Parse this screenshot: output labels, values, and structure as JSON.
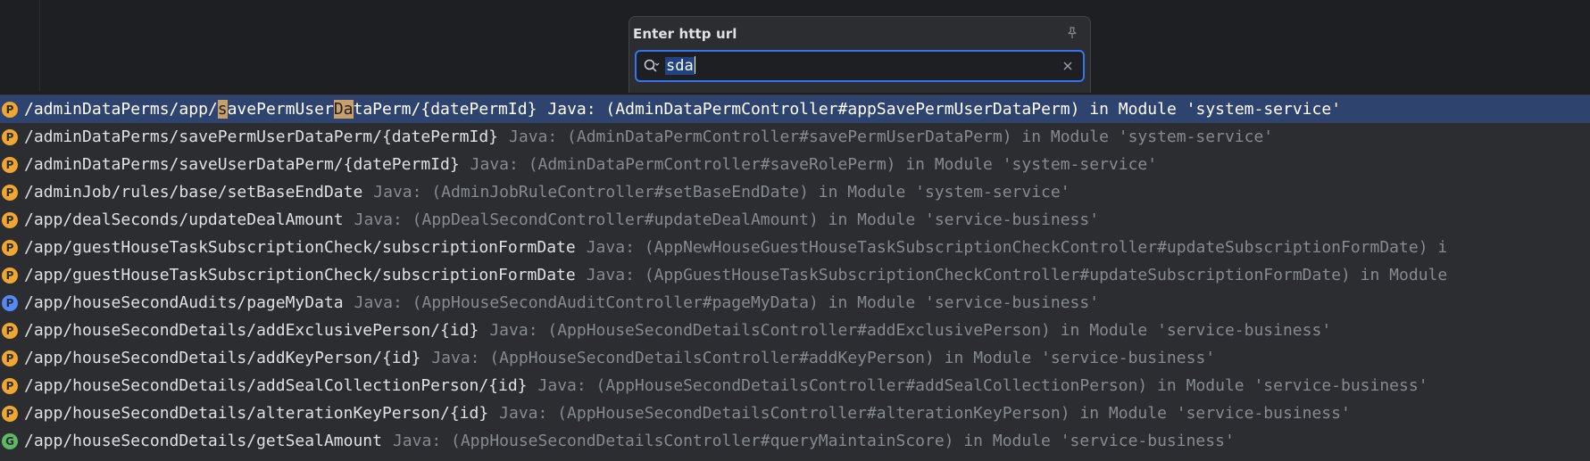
{
  "popup": {
    "title": "Enter http url",
    "search": {
      "value": "sda",
      "placeholder": ""
    }
  },
  "icons": {
    "pin": "pin-icon",
    "search": "search-icon",
    "clear": "close-icon"
  },
  "colors": {
    "selection": "#2e436e",
    "accent": "#3574f0",
    "badge_orange": "#f0a732",
    "badge_blue": "#548af7",
    "badge_green": "#5fb865",
    "match_highlight": "#c9a06a"
  },
  "results": [
    {
      "badge": "P",
      "badge_color": "orange",
      "path_parts": [
        {
          "t": "/adminDataPerms/app/",
          "h": false
        },
        {
          "t": "s",
          "h": true
        },
        {
          "t": "avePermUser",
          "h": false
        },
        {
          "t": "Da",
          "h": true
        },
        {
          "t": "taPerm/{datePermId}",
          "h": false
        }
      ],
      "desc": "Java: (AdminDataPermController#appSavePermUserDataPerm) in Module 'system-service'",
      "selected": true
    },
    {
      "badge": "P",
      "badge_color": "orange",
      "path": "/adminDataPerms/savePermUserDataPerm/{datePermId}",
      "desc": "Java: (AdminDataPermController#savePermUserDataPerm) in Module 'system-service'"
    },
    {
      "badge": "P",
      "badge_color": "orange",
      "path": "/adminDataPerms/saveUserDataPerm/{datePermId}",
      "desc": "Java: (AdminDataPermController#saveRolePerm) in Module 'system-service'"
    },
    {
      "badge": "P",
      "badge_color": "orange",
      "path": "/adminJob/rules/base/setBaseEndDate",
      "desc": "Java: (AdminJobRuleController#setBaseEndDate) in Module 'system-service'"
    },
    {
      "badge": "P",
      "badge_color": "orange",
      "path": "/app/dealSeconds/updateDealAmount",
      "desc": "Java: (AppDealSecondController#updateDealAmount) in Module 'service-business'"
    },
    {
      "badge": "P",
      "badge_color": "orange",
      "path": "/app/guestHouseTaskSubscriptionCheck/subscriptionFormDate",
      "desc": "Java: (AppNewHouseGuestHouseTaskSubscriptionCheckController#updateSubscriptionFormDate) i"
    },
    {
      "badge": "P",
      "badge_color": "orange",
      "path": "/app/guestHouseTaskSubscriptionCheck/subscriptionFormDate",
      "desc": "Java: (AppGuestHouseTaskSubscriptionCheckController#updateSubscriptionFormDate) in Module"
    },
    {
      "badge": "P",
      "badge_color": "blue",
      "path": "/app/houseSecondAudits/pageMyData",
      "desc": "Java: (AppHouseSecondAuditController#pageMyData) in Module 'service-business'"
    },
    {
      "badge": "P",
      "badge_color": "orange",
      "path": "/app/houseSecondDetails/addExclusivePerson/{id}",
      "desc": "Java: (AppHouseSecondDetailsController#addExclusivePerson) in Module 'service-business'"
    },
    {
      "badge": "P",
      "badge_color": "orange",
      "path": "/app/houseSecondDetails/addKeyPerson/{id}",
      "desc": "Java: (AppHouseSecondDetailsController#addKeyPerson) in Module 'service-business'"
    },
    {
      "badge": "P",
      "badge_color": "orange",
      "path": "/app/houseSecondDetails/addSealCollectionPerson/{id}",
      "desc": "Java: (AppHouseSecondDetailsController#addSealCollectionPerson) in Module 'service-business'"
    },
    {
      "badge": "P",
      "badge_color": "orange",
      "path": "/app/houseSecondDetails/alterationKeyPerson/{id}",
      "desc": "Java: (AppHouseSecondDetailsController#alterationKeyPerson) in Module 'service-business'"
    },
    {
      "badge": "G",
      "badge_color": "green",
      "path": "/app/houseSecondDetails/getSealAmount",
      "desc": "Java: (AppHouseSecondDetailsController#queryMaintainScore) in Module 'service-business'"
    }
  ]
}
